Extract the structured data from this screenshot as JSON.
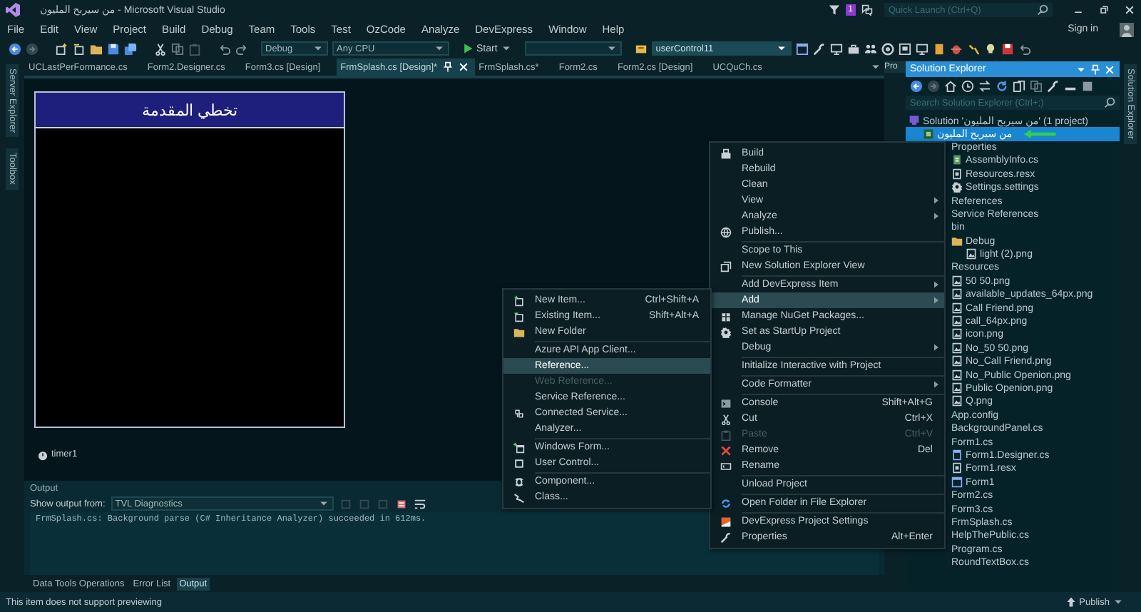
{
  "window": {
    "title": "من سيربح المليون - Microsoft Visual Studio",
    "notification_count": "1",
    "quick_launch": {
      "placeholder": "Quick Launch (Ctrl+Q)"
    }
  },
  "menu_bar": {
    "items": [
      "File",
      "Edit",
      "View",
      "Project",
      "Build",
      "Debug",
      "Team",
      "Tools",
      "Test",
      "OzCode",
      "Analyze",
      "DevExpress",
      "Window",
      "Help"
    ],
    "sign_in": "Sign in"
  },
  "toolbar": {
    "configuration": "Debug",
    "platform": "Any CPU",
    "start": "Start",
    "object_selector": "userControl11"
  },
  "left_strip": [
    "Server Explorer",
    "Toolbox"
  ],
  "document_tabs": [
    {
      "label": "UCLastPerFormance.cs",
      "selected": false
    },
    {
      "label": "Form2.Designer.cs",
      "selected": false
    },
    {
      "label": "Form3.cs [Design]",
      "selected": false
    },
    {
      "label": "FrmSplash.cs [Design]*",
      "selected": true
    },
    {
      "label": "FrmSplash.cs*",
      "selected": false
    },
    {
      "label": "Form2.cs",
      "selected": false
    },
    {
      "label": "Form2.cs [Design]",
      "selected": false
    },
    {
      "label": "UCQuCh.cs",
      "selected": false
    }
  ],
  "designer": {
    "form_title": "تخطي المقدمة",
    "components": [
      "timer1"
    ]
  },
  "output": {
    "title": "Output",
    "source_label": "Show output from:",
    "source": "TVL Diagnostics",
    "lines": [
      "FrmSplash.cs: Background parse (C# Inheritance Analyzer) succeeded in 612ms."
    ]
  },
  "bottom_tabs": [
    {
      "label": "Data Tools Operations",
      "selected": false
    },
    {
      "label": "Error List",
      "selected": false
    },
    {
      "label": "Output",
      "selected": true
    }
  ],
  "properties_tab": {
    "label": "Pro"
  },
  "solution_explorer": {
    "title": "Solution Explorer",
    "search": {
      "placeholder": "Search Solution Explorer (Ctrl+;)"
    },
    "tree": [
      {
        "label": "Solution 'من سيربح المليون' (1 project)",
        "kind": "solution",
        "selected": false,
        "children": [
          {
            "label": "من سيربح المليون",
            "kind": "project",
            "selected": true,
            "children": [
              {
                "label": "Properties",
                "selected": false,
                "children": [
                  {
                    "label": "AssemblyInfo.cs",
                    "kind": "csharp",
                    "selected": false
                  },
                  {
                    "label": "Resources.resx",
                    "kind": "resx",
                    "selected": false
                  },
                  {
                    "label": "Settings.settings",
                    "kind": "settings",
                    "selected": false
                  }
                ]
              },
              {
                "label": "References",
                "selected": false
              },
              {
                "label": "Service References",
                "selected": false
              },
              {
                "label": "bin",
                "selected": false,
                "children": [
                  {
                    "label": "Debug",
                    "kind": "folder",
                    "selected": false,
                    "children": [
                      {
                        "label": "light (2).png",
                        "kind": "image",
                        "selected": false
                      }
                    ]
                  }
                ]
              },
              {
                "label": "Resources",
                "selected": false,
                "children": [
                  {
                    "label": "50 50.png",
                    "kind": "image",
                    "selected": false
                  },
                  {
                    "label": "available_updates_64px.png",
                    "kind": "image",
                    "selected": false
                  },
                  {
                    "label": "Call Friend.png",
                    "kind": "image",
                    "selected": false
                  },
                  {
                    "label": "call_64px.png",
                    "kind": "image",
                    "selected": false
                  },
                  {
                    "label": "icon.png",
                    "kind": "image",
                    "selected": false
                  },
                  {
                    "label": "No_50 50.png",
                    "kind": "image",
                    "selected": false
                  },
                  {
                    "label": "No_Call Friend.png",
                    "kind": "image",
                    "selected": false
                  },
                  {
                    "label": "No_Public Openion.png",
                    "kind": "image",
                    "selected": false
                  },
                  {
                    "label": "Public Openion.png",
                    "kind": "image",
                    "selected": false
                  },
                  {
                    "label": "Q.png",
                    "kind": "image",
                    "selected": false
                  }
                ]
              },
              {
                "label": "App.config",
                "selected": false
              },
              {
                "label": "BackgroundPanel.cs",
                "selected": false
              },
              {
                "label": "Form1.cs",
                "selected": false,
                "children": [
                  {
                    "label": "Form1.Designer.cs",
                    "kind": "designer",
                    "selected": false
                  },
                  {
                    "label": "Form1.resx",
                    "kind": "resx",
                    "selected": false
                  },
                  {
                    "label": "Form1",
                    "kind": "form",
                    "selected": false
                  }
                ]
              },
              {
                "label": "Form2.cs",
                "selected": false
              },
              {
                "label": "Form3.cs",
                "selected": false
              },
              {
                "label": "FrmSplash.cs",
                "selected": false
              },
              {
                "label": "HelpThePublic.cs",
                "selected": false
              },
              {
                "label": "Program.cs",
                "selected": false
              },
              {
                "label": "RoundTextBox.cs",
                "selected": false
              }
            ]
          }
        ]
      }
    ]
  },
  "right_strip": "Solution Explorer",
  "context_menu": {
    "items": [
      {
        "kind": "item",
        "label": "Build",
        "selected": false,
        "disabled": false
      },
      {
        "kind": "item",
        "label": "Rebuild",
        "selected": false,
        "disabled": false
      },
      {
        "kind": "item",
        "label": "Clean",
        "selected": false,
        "disabled": false
      },
      {
        "kind": "submenu",
        "label": "View",
        "selected": false,
        "disabled": false
      },
      {
        "kind": "submenu",
        "label": "Analyze",
        "selected": false,
        "disabled": false
      },
      {
        "kind": "item",
        "label": "Publish...",
        "selected": false,
        "disabled": false
      },
      {
        "kind": "separator"
      },
      {
        "kind": "item",
        "label": "Scope to This",
        "selected": false,
        "disabled": false
      },
      {
        "kind": "item",
        "label": "New Solution Explorer View",
        "selected": false,
        "disabled": false
      },
      {
        "kind": "separator"
      },
      {
        "kind": "submenu",
        "label": "Add DevExpress Item",
        "selected": false,
        "disabled": false
      },
      {
        "kind": "submenu",
        "label": "Add",
        "selected": true,
        "disabled": false
      },
      {
        "kind": "item",
        "label": "Manage NuGet Packages...",
        "selected": false,
        "disabled": false
      },
      {
        "kind": "item",
        "label": "Set as StartUp Project",
        "selected": false,
        "disabled": false
      },
      {
        "kind": "submenu",
        "label": "Debug",
        "selected": false,
        "disabled": false
      },
      {
        "kind": "separator"
      },
      {
        "kind": "item",
        "label": "Initialize Interactive with Project",
        "selected": false,
        "disabled": false
      },
      {
        "kind": "separator"
      },
      {
        "kind": "submenu",
        "label": "Code Formatter",
        "selected": false,
        "disabled": false
      },
      {
        "kind": "separator"
      },
      {
        "kind": "item",
        "label": "Console",
        "shortcut": "Shift+Alt+G",
        "selected": false,
        "disabled": false
      },
      {
        "kind": "item",
        "label": "Cut",
        "shortcut": "Ctrl+X",
        "selected": false,
        "disabled": false
      },
      {
        "kind": "item",
        "label": "Paste",
        "shortcut": "Ctrl+V",
        "selected": false,
        "disabled": true
      },
      {
        "kind": "item",
        "label": "Remove",
        "shortcut": "Del",
        "selected": false,
        "disabled": false
      },
      {
        "kind": "item",
        "label": "Rename",
        "selected": false,
        "disabled": false
      },
      {
        "kind": "separator"
      },
      {
        "kind": "item",
        "label": "Unload Project",
        "selected": false,
        "disabled": false
      },
      {
        "kind": "separator"
      },
      {
        "kind": "item",
        "label": "Open Folder in File Explorer",
        "selected": false,
        "disabled": false
      },
      {
        "kind": "separator"
      },
      {
        "kind": "item",
        "label": "DevExpress Project Settings",
        "selected": false,
        "disabled": false
      },
      {
        "kind": "item",
        "label": "Properties",
        "shortcut": "Alt+Enter",
        "selected": false,
        "disabled": false
      }
    ]
  },
  "submenu": {
    "items": [
      {
        "kind": "item",
        "label": "New Item...",
        "shortcut": "Ctrl+Shift+A",
        "selected": false,
        "disabled": false
      },
      {
        "kind": "item",
        "label": "Existing Item...",
        "shortcut": "Shift+Alt+A",
        "selected": false,
        "disabled": false
      },
      {
        "kind": "item",
        "label": "New Folder",
        "selected": false,
        "disabled": false
      },
      {
        "kind": "separator"
      },
      {
        "kind": "item",
        "label": "Azure API App Client...",
        "selected": false,
        "disabled": false
      },
      {
        "kind": "item",
        "label": "Reference...",
        "selected": true,
        "disabled": false
      },
      {
        "kind": "item",
        "label": "Web Reference...",
        "selected": false,
        "disabled": true
      },
      {
        "kind": "item",
        "label": "Service Reference...",
        "selected": false,
        "disabled": false
      },
      {
        "kind": "item",
        "label": "Connected Service...",
        "selected": false,
        "disabled": false
      },
      {
        "kind": "item",
        "label": "Analyzer...",
        "selected": false,
        "disabled": false
      },
      {
        "kind": "separator"
      },
      {
        "kind": "item",
        "label": "Windows Form...",
        "selected": false,
        "disabled": false
      },
      {
        "kind": "item",
        "label": "User Control...",
        "selected": false,
        "disabled": false
      },
      {
        "kind": "separator"
      },
      {
        "kind": "item",
        "label": "Component...",
        "selected": false,
        "disabled": false
      },
      {
        "kind": "item",
        "label": "Class...",
        "selected": false,
        "disabled": false
      }
    ]
  },
  "status_bar": {
    "message": "This item does not support previewing",
    "publish": "Publish"
  }
}
